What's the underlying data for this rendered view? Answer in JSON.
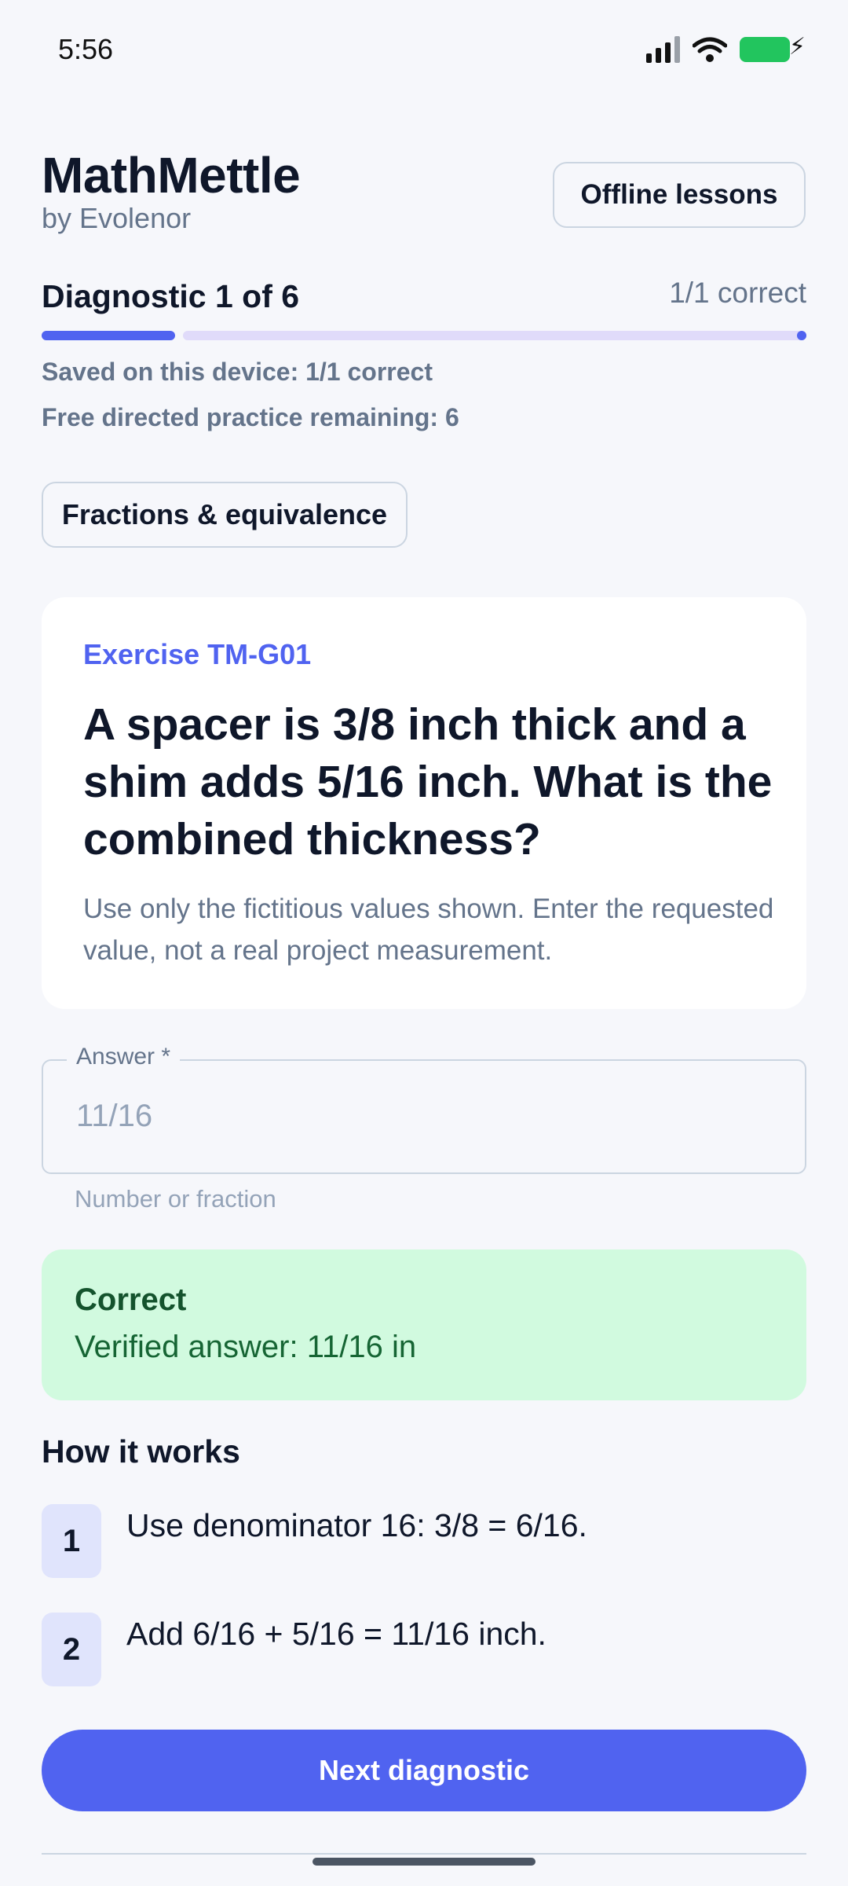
{
  "status_bar": {
    "time": "5:56",
    "icons": [
      "signal-icon",
      "wifi-icon",
      "battery-charging-icon"
    ],
    "battery_color": "#22c55e"
  },
  "header": {
    "title": "MathMettle",
    "subtitle": "by Evolenor",
    "offline_button": "Offline lessons"
  },
  "progress": {
    "label": "Diagnostic 1 of 6",
    "correct_summary": "1/1 correct",
    "completed_fraction": 0.1667,
    "saved_text": "Saved on this device: 1/1 correct",
    "free_practice_text": "Free directed practice remaining: 6"
  },
  "topic_chip": "Fractions & equivalence",
  "question": {
    "exercise_id": "Exercise TM-G01",
    "text": "A spacer is 3/8 inch thick and a shim adds 5/16 inch. What is the combined thickness?",
    "hint": "Use only the fictitious values shown. Enter the requested value, not a real project measurement."
  },
  "answer": {
    "label": "Answer *",
    "value": "11/16",
    "helper": "Number or fraction"
  },
  "result": {
    "title": "Correct",
    "detail": "Verified answer: 11/16 in"
  },
  "how_it_works": {
    "title": "How it works",
    "steps": [
      {
        "number": "1",
        "text": "Use denominator 16: 3/8 = 6/16."
      },
      {
        "number": "2",
        "text": "Add 6/16 + 5/16 = 11/16 inch."
      }
    ]
  },
  "next_button": "Next diagnostic",
  "colors": {
    "accent": "#5063f0",
    "success_bg": "#d1fadf",
    "success_text": "#14532d"
  }
}
